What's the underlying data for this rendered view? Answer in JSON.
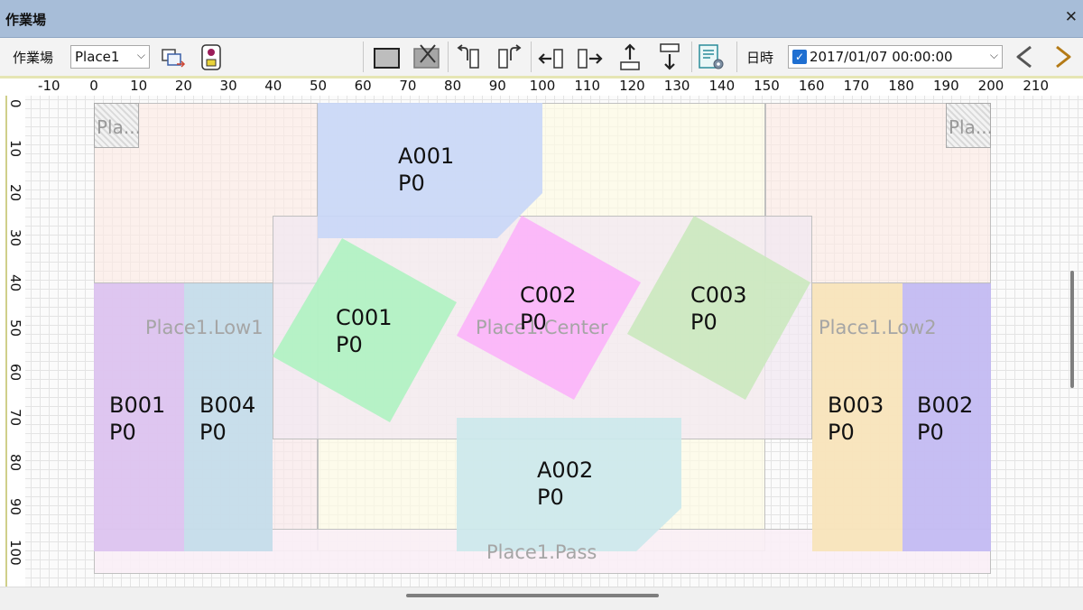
{
  "window": {
    "title": "作業場",
    "close_icon": "close-icon"
  },
  "toolbar": {
    "place_label": "作業場",
    "place_value": "Place1",
    "date_label": "日時",
    "date_value": "2017/01/07 00:00:00",
    "date_enabled": true
  },
  "ruler": {
    "x_ticks": [
      "-10",
      "0",
      "10",
      "20",
      "30",
      "40",
      "50",
      "60",
      "70",
      "80",
      "90",
      "100",
      "110",
      "120",
      "130",
      "140",
      "150",
      "160",
      "170",
      "180",
      "190",
      "200",
      "210"
    ],
    "y_ticks": [
      "0",
      "10",
      "20",
      "30",
      "40",
      "50",
      "60",
      "70",
      "80",
      "90",
      "100"
    ]
  },
  "areas": {
    "low1_label": "Place1.Low1",
    "center_label": "Place1.Center",
    "low2_label": "Place1.Low2",
    "pass_label": "Place1.Pass",
    "corner_tl_label": "Pla...",
    "corner_tr_label": "Pla..."
  },
  "items": {
    "a001": {
      "name": "A001",
      "sub": "P0",
      "color": "#c9d7f7"
    },
    "a002": {
      "name": "A002",
      "sub": "P0",
      "color": "#cce8ec"
    },
    "b001": {
      "name": "B001",
      "sub": "P0",
      "color": "#dcc3ef"
    },
    "b004": {
      "name": "B004",
      "sub": "P0",
      "color": "#c5dcea"
    },
    "b003": {
      "name": "B003",
      "sub": "P0",
      "color": "#f8e4ba"
    },
    "b002": {
      "name": "B002",
      "sub": "P0",
      "color": "#c3bbf2"
    },
    "c001": {
      "name": "C001",
      "sub": "P0",
      "color": "#b0f2c2"
    },
    "c002": {
      "name": "C002",
      "sub": "P0",
      "color": "#fbb4fa"
    },
    "c003": {
      "name": "C003",
      "sub": "P0",
      "color": "#cbe8bf"
    }
  }
}
